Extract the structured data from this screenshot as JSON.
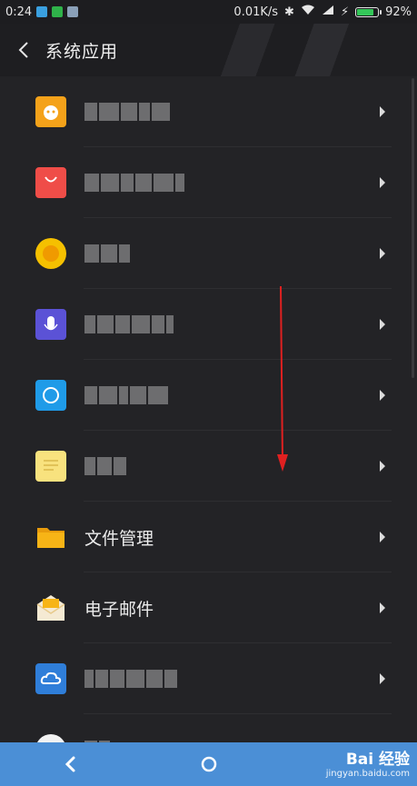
{
  "status_bar": {
    "time": "0:24",
    "net_speed": "0.01K/s",
    "battery_percent": "92%",
    "battery_level": 0.92
  },
  "header": {
    "title": "系统应用"
  },
  "apps": [
    {
      "label": "",
      "icon": "orange-monster-icon",
      "color": "#f4a21a"
    },
    {
      "label": "",
      "icon": "shopping-bag-icon",
      "color": "#ef4d48"
    },
    {
      "label": "",
      "icon": "yellow-circle-icon",
      "color": "#f5c000"
    },
    {
      "label": "",
      "icon": "microphone-icon",
      "color": "#5b52d6"
    },
    {
      "label": "",
      "icon": "compass-icon",
      "color": "#1f9be8"
    },
    {
      "label": "",
      "icon": "notes-icon",
      "color": "#f8e27e"
    },
    {
      "label": "文件管理",
      "icon": "folder-icon",
      "color": "#f7b416"
    },
    {
      "label": "电子邮件",
      "icon": "mail-icon",
      "color": "#f5ead3"
    },
    {
      "label": "",
      "icon": "cloud-icon",
      "color": "#2f7ed9"
    }
  ],
  "watermark": {
    "brand": "Bai 经验",
    "url": "jingyan.baidu.com"
  }
}
